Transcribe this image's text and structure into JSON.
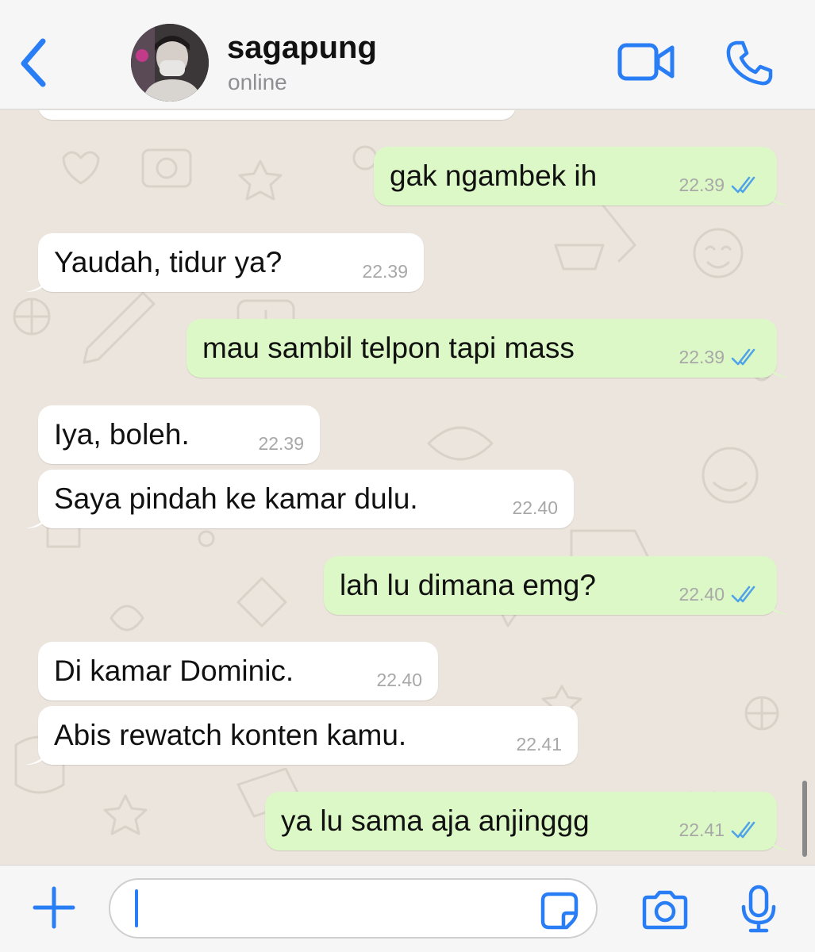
{
  "header": {
    "name": "sagapung",
    "status": "online",
    "icons": {
      "back": "chevron-left-icon",
      "video": "video-camera-icon",
      "call": "phone-icon"
    }
  },
  "messages": [
    {
      "direction": "out",
      "text": "gak ngambek ih",
      "time": "22.39",
      "status": "read"
    },
    {
      "direction": "in",
      "text": "Yaudah, tidur ya?",
      "time": "22.39"
    },
    {
      "direction": "out",
      "text": "mau sambil telpon tapi mass",
      "time": "22.39",
      "status": "read"
    },
    {
      "direction": "in",
      "text": "Iya, boleh.",
      "time": "22.39"
    },
    {
      "direction": "in",
      "text": "Saya pindah ke kamar dulu.",
      "time": "22.40"
    },
    {
      "direction": "out",
      "text": "lah lu dimana emg?",
      "time": "22.40",
      "status": "read"
    },
    {
      "direction": "in",
      "text": "Di kamar Dominic.",
      "time": "22.40"
    },
    {
      "direction": "in",
      "text": "Abis rewatch konten kamu.",
      "time": "22.41"
    },
    {
      "direction": "out",
      "text": "ya lu sama aja anjinggg",
      "time": "22.41",
      "status": "read"
    }
  ],
  "composer": {
    "value": "",
    "icons": {
      "plus": "plus-icon",
      "sticker": "sticker-icon",
      "camera": "camera-icon",
      "mic": "microphone-icon"
    }
  },
  "colors": {
    "accent": "#2a7ef5",
    "incoming_bubble": "#ffffff",
    "outgoing_bubble": "#dcf8c6",
    "chat_background": "#ece5dd",
    "read_ticks": "#4fa3e8"
  }
}
